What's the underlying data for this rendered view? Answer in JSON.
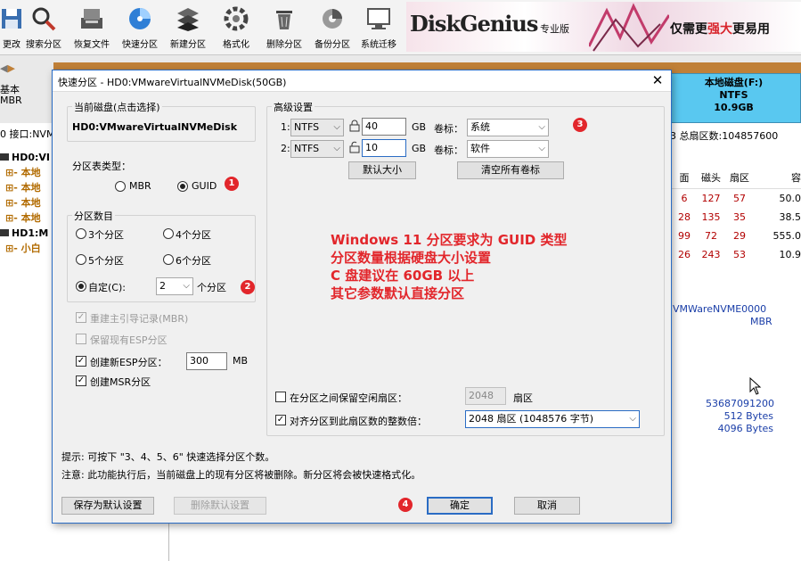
{
  "toolbar": {
    "items": [
      {
        "label": "更改",
        "icon": "save-icon"
      },
      {
        "label": "搜索分区",
        "icon": "search-icon"
      },
      {
        "label": "恢复文件",
        "icon": "recover-files-icon"
      },
      {
        "label": "快速分区",
        "icon": "quick-partition-icon"
      },
      {
        "label": "新建分区",
        "icon": "new-partition-icon"
      },
      {
        "label": "格式化",
        "icon": "format-icon"
      },
      {
        "label": "删除分区",
        "icon": "delete-icon"
      },
      {
        "label": "备份分区",
        "icon": "backup-icon"
      },
      {
        "label": "系统迁移",
        "icon": "migrate-icon"
      }
    ],
    "banner_brand": "DiskGenius",
    "banner_sub": "专业版",
    "banner_slogan_pre": "仅需更",
    "banner_slogan_em": "强大",
    "banner_slogan_post": "更易用"
  },
  "background": {
    "left_top": "基本",
    "left_mbr": "MBR",
    "left_iface": "0 接口:NVM",
    "tree": [
      "HD0:VI",
      "本地",
      "本地",
      "本地",
      "本地",
      "HD1:M",
      "小白"
    ],
    "right_disk": {
      "name": "本地磁盘(F:)",
      "fs": "NTFS",
      "size": "10.9GB"
    },
    "sector_info": "3  总扇区数:104857600",
    "table_headers": [
      "面",
      "磁头",
      "扇区",
      "容"
    ],
    "table_rows": [
      [
        "6",
        "127",
        "57",
        "50.0"
      ],
      [
        "28",
        "135",
        "35",
        "38.5"
      ],
      [
        "99",
        "72",
        "29",
        "555.0"
      ],
      [
        "26",
        "243",
        "53",
        "10.9"
      ]
    ],
    "model": "VMWareNVME0000",
    "model_type": "MBR",
    "numbers": [
      "53687091200",
      "512 Bytes",
      "4096 Bytes"
    ]
  },
  "dialog": {
    "title": "快速分区 - HD0:VMwareVirtualNVMeDisk(50GB)",
    "current_disk_label": "当前磁盘(点击选择)",
    "current_disk_value": "HD0:VMwareVirtualNVMeDisk",
    "partition_type_label": "分区表类型：",
    "mbr_label": "MBR",
    "guid_label": "GUID",
    "partition_count_label": "分区数目",
    "options": [
      "3个分区",
      "4个分区",
      "5个分区",
      "6个分区"
    ],
    "custom_label": "自定(C):",
    "custom_value": "2",
    "custom_suffix": "个分区",
    "rebuild_mbr": "重建主引导记录(MBR)",
    "keep_esp": "保留现有ESP分区",
    "create_esp": "创建新ESP分区：",
    "esp_size": "300",
    "esp_unit": "MB",
    "create_msr": "创建MSR分区",
    "advanced_label": "高级设置",
    "rows": [
      {
        "idx": "1:",
        "fs": "NTFS",
        "size": "40",
        "unit": "GB",
        "vol_label": "卷标：",
        "vol": "系统"
      },
      {
        "idx": "2:",
        "fs": "NTFS",
        "size": "10",
        "unit": "GB",
        "vol_label": "卷标：",
        "vol": "软件"
      }
    ],
    "default_size_btn": "默认大小",
    "clear_labels_btn": "清空所有卷标",
    "annotation": [
      "Windows 11 分区要求为 GUID 类型",
      "分区数量根据硬盘大小设置",
      "C 盘建议在 60GB 以上",
      "其它参数默认直接分区"
    ],
    "reserve_label": "在分区之间保留空闲扇区：",
    "reserve_value": "2048",
    "reserve_unit": "扇区",
    "align_label": "对齐分区到此扇区数的整数倍：",
    "align_value": "2048 扇区 (1048576 字节)",
    "tip": "提示: 可按下 \"3、4、5、6\" 快速选择分区个数。",
    "note": "注意: 此功能执行后，当前磁盘上的现有分区将被删除。新分区将会被快速格式化。",
    "save_default_btn": "保存为默认设置",
    "delete_default_btn": "删除默认设置",
    "ok_btn": "确定",
    "cancel_btn": "取消",
    "badges": [
      "1",
      "2",
      "3",
      "4"
    ]
  }
}
